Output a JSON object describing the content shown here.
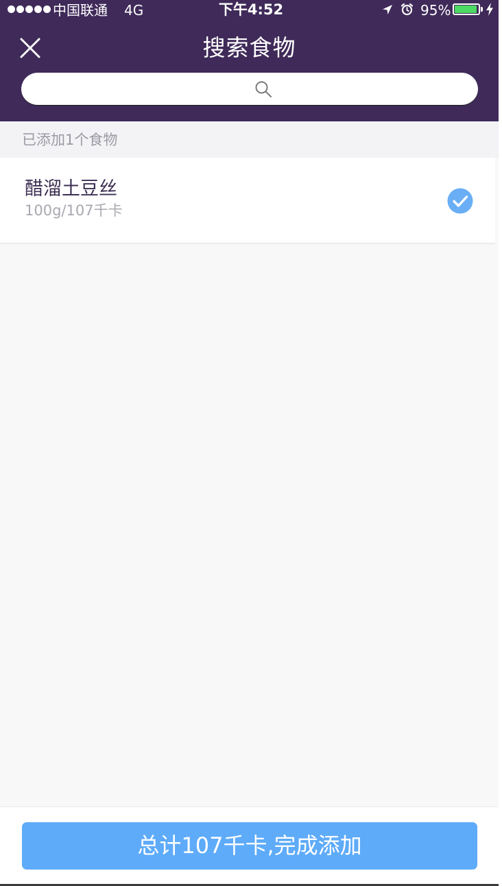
{
  "status_bar": {
    "carrier": "中国联通",
    "network": "4G",
    "time": "下午4:52",
    "battery_percent": "95%",
    "battery_level": 0.95,
    "icons": [
      "signal-dots-icon",
      "location-arrow-icon",
      "alarm-clock-icon",
      "battery-icon",
      "charging-bolt-icon"
    ]
  },
  "nav": {
    "title": "搜索食物",
    "close_icon": "close-icon"
  },
  "search": {
    "placeholder": "",
    "value": "",
    "icon": "search-icon"
  },
  "added": {
    "header": "已添加1个食物",
    "items": [
      {
        "name": "醋溜土豆丝",
        "meta": "100g/107千卡",
        "selected": true
      }
    ]
  },
  "footer": {
    "button_label": "总计107千卡,完成添加"
  },
  "colors": {
    "header_bg": "#3f2a59",
    "accent_blue": "#5eabf9",
    "check_blue": "#6aaef5",
    "battery_green": "#4cd964"
  }
}
